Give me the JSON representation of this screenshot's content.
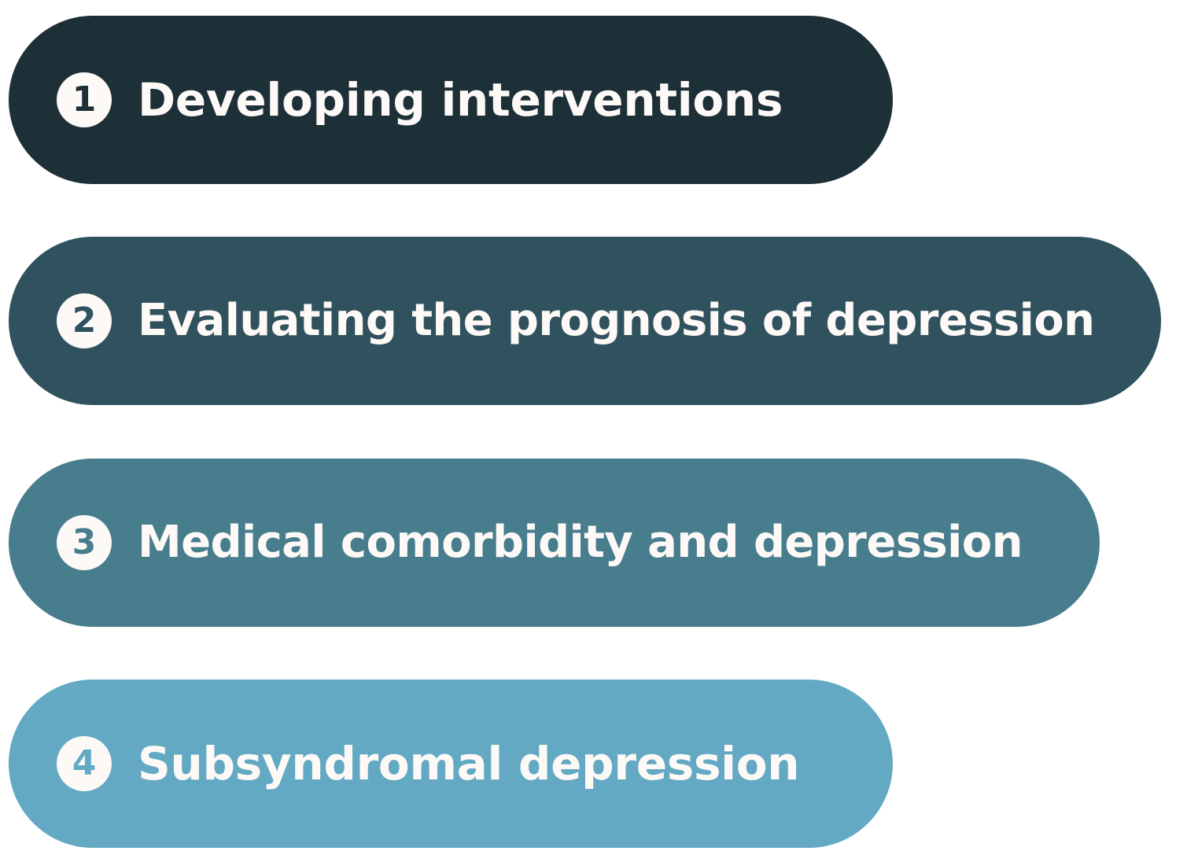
{
  "items": [
    {
      "number": "1",
      "label": "Developing interventions",
      "color": "#1d2f37"
    },
    {
      "number": "2",
      "label": "Evaluating the prognosis of depression",
      "color": "#30525e"
    },
    {
      "number": "3",
      "label": "Medical comorbidity and depression",
      "color": "#487d8e"
    },
    {
      "number": "4",
      "label": "Subsyndromal depression",
      "color": "#63a9c4"
    }
  ],
  "badge_color": "#fdf9f6",
  "text_color": "#fdf9f6"
}
